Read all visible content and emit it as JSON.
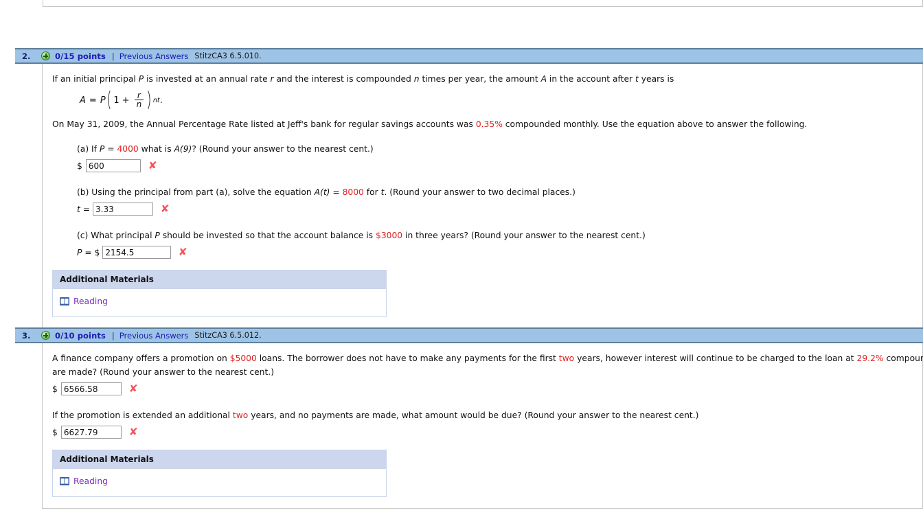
{
  "page": {
    "background": "#ffffff",
    "header_bar_color": "#9dc3e6",
    "header_border_color": "#5d7f9b",
    "accent_red": "#e02020",
    "link_blue": "#1b1bb3",
    "visited_purple": "#7b2fbe",
    "x_mark_color": "#f4545c"
  },
  "questions": [
    {
      "number": "2.",
      "status_icon": "plus-circle-icon",
      "points": "0/15 points",
      "separator": "|",
      "previous_answers": "Previous Answers",
      "reference": "StitzCA3 6.5.010.",
      "intro_before": "If an initial principal ",
      "intro_p": "P",
      "intro_mid1": " is invested at an annual rate ",
      "intro_r": "r",
      "intro_mid2": " and the interest is compounded ",
      "intro_n": "n",
      "intro_mid3": " times per year, the amount ",
      "intro_a": "A",
      "intro_mid4": " in the account after ",
      "intro_t": "t",
      "intro_end": " years is",
      "formula": {
        "lhs": "A",
        "eq": "=",
        "p": "P",
        "open": "(",
        "one": "1",
        "plus": "+",
        "frac_num": "r",
        "frac_den": "n",
        "close": ")",
        "exponent": "nt",
        "period": "."
      },
      "context_pre": "On May 31, 2009, the Annual Percentage Rate listed at Jeff's bank for regular savings accounts was ",
      "context_rate": "0.35%",
      "context_post": " compounded monthly. Use the equation above to answer the following.",
      "parts": [
        {
          "label_pre": "(a) If ",
          "var1": "P",
          "label_mid": " = ",
          "value1": "4000",
          "label_mid2": " what is ",
          "var2": "A(9)",
          "label_post": "? (Round your answer to the nearest cent.)",
          "prefix": "$",
          "input_value": "600",
          "input_width": 80,
          "mark": "incorrect-x-icon"
        },
        {
          "label_pre": "(b) Using the principal from part (a), solve the equation ",
          "var1": "A(t)",
          "label_mid": " = ",
          "value1": "8000",
          "label_mid2": " for ",
          "var2": "t",
          "label_post": ". (Round your answer to two decimal places.)",
          "prefix": "t =",
          "input_value": "3.33",
          "input_width": 88,
          "mark": "incorrect-x-icon"
        },
        {
          "label_pre": "(c) What principal ",
          "var1": "P",
          "label_mid": " should be invested so that the account balance is ",
          "value1": "$3000",
          "label_mid2": " in three years? (Round your answer to the nearest cent.)",
          "var2": "",
          "label_post": "",
          "prefix": "P = $",
          "input_value": "2154.5",
          "input_width": 100,
          "mark": "incorrect-x-icon"
        }
      ],
      "additional_materials": {
        "title": "Additional Materials",
        "link_label": "Reading",
        "link_icon": "book-icon"
      }
    },
    {
      "number": "3.",
      "status_icon": "plus-circle-icon",
      "points": "0/10 points",
      "separator": "|",
      "previous_answers": "Previous Answers",
      "reference": "StitzCA3 6.5.012.",
      "body_pre": "A finance company offers a promotion on ",
      "body_amount": "$5000",
      "body_mid1": " loans. The borrower does not have to make any payments for the first ",
      "body_years": "two",
      "body_mid2": " years, however interest will continue to be charged to the loan at ",
      "body_rate": "29.2%",
      "body_mid3": " compounded continuously. What amount will be due after ",
      "body_tail": "are made? (Round your answer to the nearest cent.)",
      "answer1": {
        "prefix": "$",
        "input_value": "6566.58",
        "input_width": 88,
        "mark": "incorrect-x-icon"
      },
      "q2_pre": "If the promotion is extended an additional ",
      "q2_years": "two",
      "q2_post": " years, and no payments are made, what amount would be due? (Round your answer to the nearest cent.)",
      "answer2": {
        "prefix": "$",
        "input_value": "6627.79",
        "input_width": 88,
        "mark": "incorrect-x-icon"
      },
      "additional_materials": {
        "title": "Additional Materials",
        "link_label": "Reading",
        "link_icon": "book-icon"
      }
    }
  ]
}
